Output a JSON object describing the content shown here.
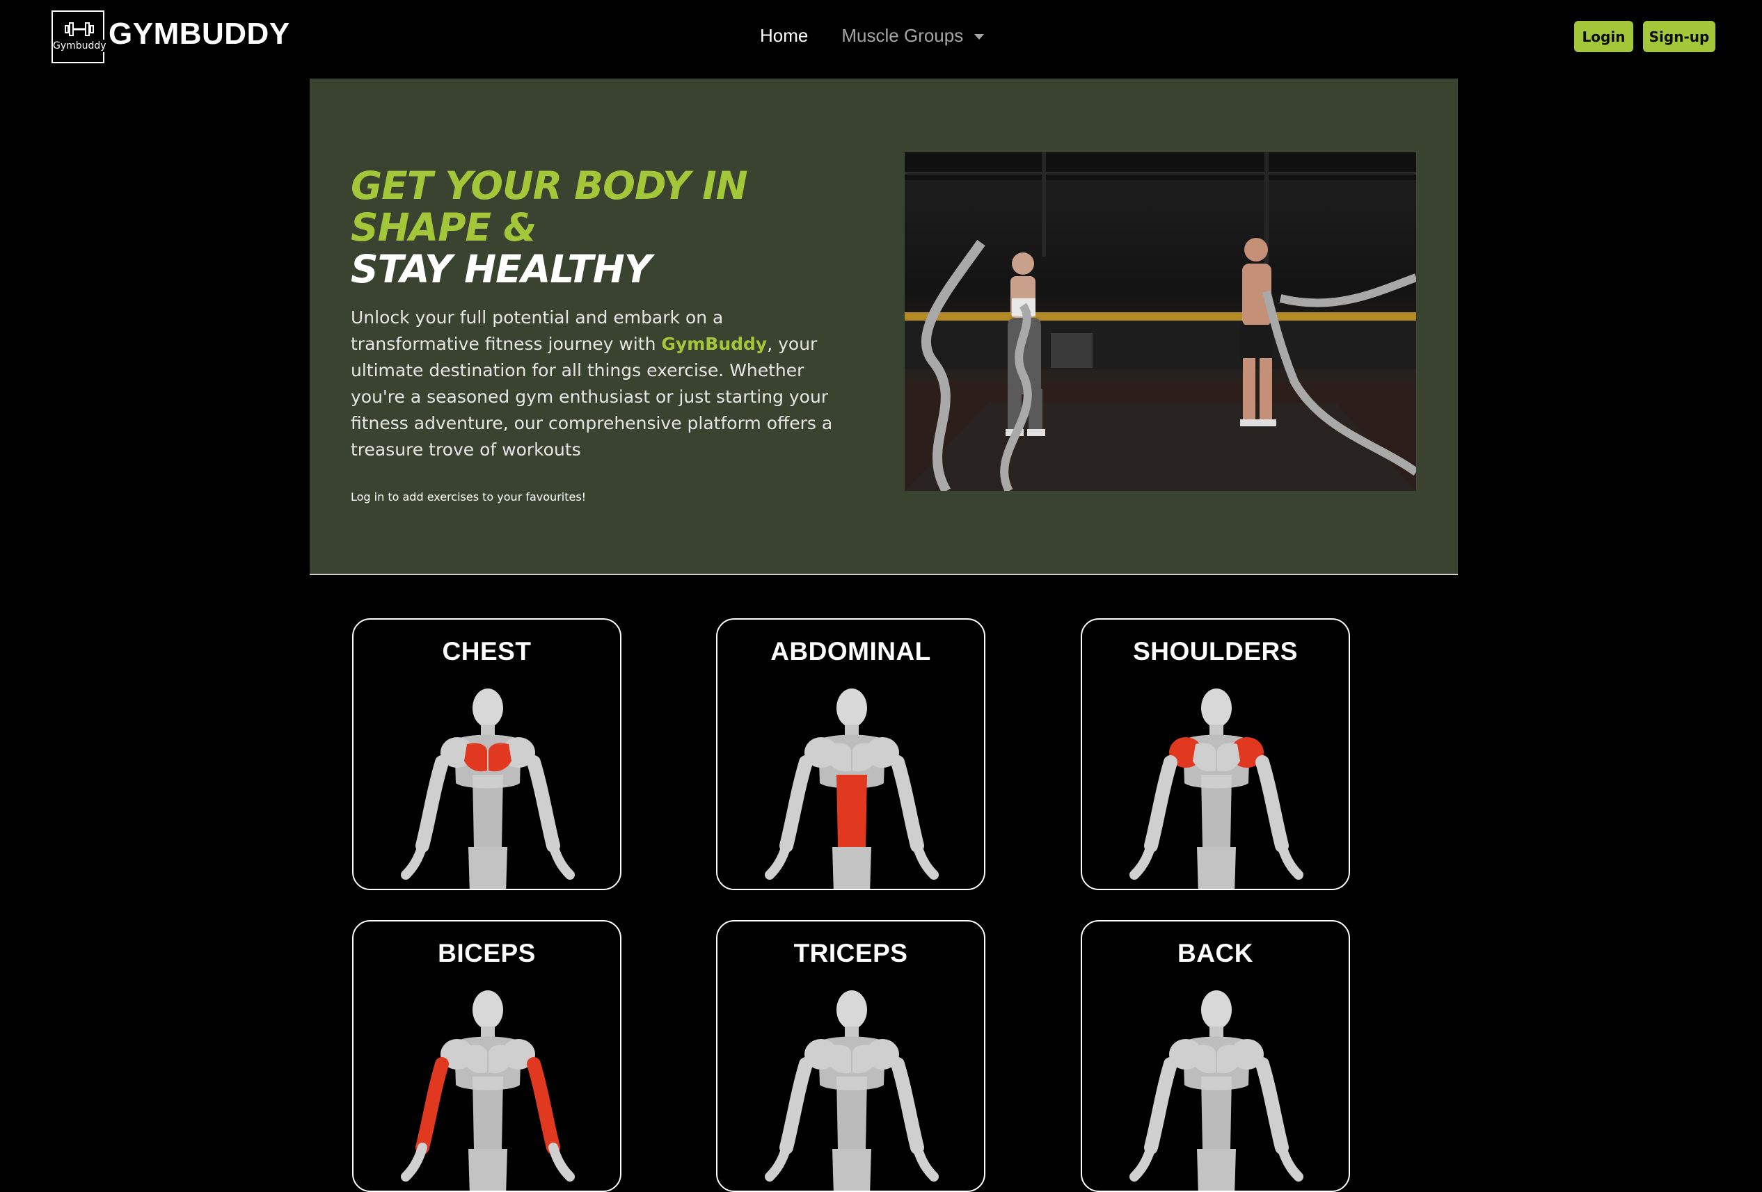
{
  "brand": {
    "logo_text": "Gymbuddy",
    "name": "GYMBUDDY",
    "accent_color": "#a4c639"
  },
  "nav": {
    "home": "Home",
    "muscle_groups": "Muscle Groups"
  },
  "auth": {
    "login": "Login",
    "signup": "Sign-up"
  },
  "hero": {
    "title_line1": "GET YOUR BODY IN SHAPE &",
    "title_line2": "STAY HEALTHY",
    "text_before": "Unlock your full potential and embark on a transformative fitness journey with ",
    "text_brand": "GymBuddy",
    "text_after": ", your ultimate destination for all things exercise. Whether you're a seasoned gym enthusiast or just starting your fitness adventure, our comprehensive platform offers a treasure trove of workouts",
    "note": "Log in to add exercises to your favourites!"
  },
  "muscle_groups": [
    {
      "label": "CHEST",
      "highlight": "chest"
    },
    {
      "label": "ABDOMINAL",
      "highlight": "abs"
    },
    {
      "label": "SHOULDERS",
      "highlight": "shoulders"
    },
    {
      "label": "BICEPS",
      "highlight": "biceps"
    },
    {
      "label": "TRICEPS",
      "highlight": "triceps"
    },
    {
      "label": "BACK",
      "highlight": "back"
    }
  ]
}
